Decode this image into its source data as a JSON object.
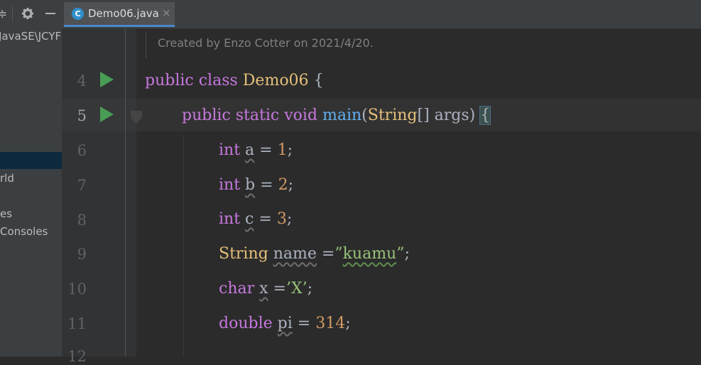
{
  "sidebar": {
    "toolbar_icons": [
      "collapse-icon",
      "gear-icon",
      "minimize-icon"
    ],
    "path_text": "JavaSE\\JCYF",
    "item_world": "rld",
    "item_libraries": "es",
    "item_consoles": "Consoles"
  },
  "tab": {
    "label": "Demo06.java",
    "icon_letter": "C",
    "close": "×"
  },
  "editor": {
    "comment": "Created by Enzo Cotter on 2021/4/20.",
    "line_numbers": [
      "4",
      "5",
      "6",
      "7",
      "8",
      "9",
      "10",
      "11",
      "12"
    ],
    "current_line": "5",
    "lines": {
      "l4": {
        "kw1": "public",
        "kw2": "class",
        "name": "Demo06",
        "brace": "{"
      },
      "l5": {
        "kw1": "public",
        "kw2": "static",
        "kw3": "void",
        "method": "main",
        "open": "(",
        "type": "String",
        "arr": "[]",
        "param": "args",
        "close": ")",
        "brace": "{"
      },
      "l6": {
        "type": "int",
        "var": "a",
        "op": "=",
        "val": "1",
        "semi": ";"
      },
      "l7": {
        "type": "int",
        "var": "b",
        "op": "=",
        "val": "2",
        "semi": ";"
      },
      "l8": {
        "type": "int",
        "var": "c",
        "op": "=",
        "val": "3",
        "semi": ";"
      },
      "l9": {
        "type": "String",
        "var": "name",
        "op": "=",
        "q1": "”",
        "val": "kuamu",
        "q2": "”",
        "semi": ";"
      },
      "l10": {
        "type": "char",
        "var": "x",
        "op": "=",
        "val": "’X’",
        "semi": ";"
      },
      "l11": {
        "type": "double",
        "var": "pi",
        "op": "=",
        "val": "314",
        "semi": ";"
      }
    }
  },
  "colors": {
    "background": "#2b2b2b",
    "keyword": "#c678dd",
    "class_name": "#e5c07b",
    "method": "#61afef",
    "number": "#d19a66",
    "string": "#98c379",
    "run_icon": "#499c54"
  }
}
